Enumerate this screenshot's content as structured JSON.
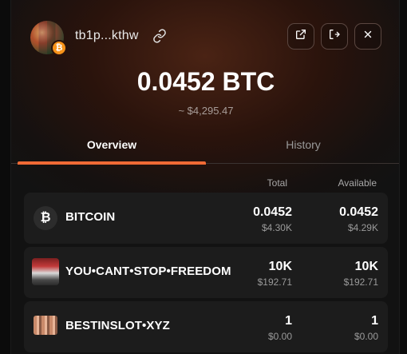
{
  "header": {
    "address": "tb1p...kthw",
    "icons": [
      "copy-link-icon",
      "external-link-icon",
      "logout-icon",
      "close-icon"
    ]
  },
  "balance": {
    "amount": "0.0452 BTC",
    "usd": "~ $4,295.47"
  },
  "tabs": [
    {
      "label": "Overview",
      "active": true
    },
    {
      "label": "History",
      "active": false
    }
  ],
  "columns": {
    "total": "Total",
    "available": "Available"
  },
  "assets": [
    {
      "name": "BITCOIN",
      "total": "0.0452",
      "total_usd": "$4.30K",
      "available": "0.0452",
      "available_usd": "$4.29K",
      "icon": "bitcoin-icon"
    },
    {
      "name": "YOU•CANT•STOP•FREEDOM",
      "total": "10K",
      "total_usd": "$192.71",
      "available": "10K",
      "available_usd": "$192.71",
      "icon": "rune-image"
    },
    {
      "name": "BESTINSLOT•XYZ",
      "total": "1",
      "total_usd": "$0.00",
      "available": "1",
      "available_usd": "$0.00",
      "icon": "rune-image"
    }
  ],
  "colors": {
    "accent": "#f06a35",
    "row_bg": "#1c1c1c",
    "bitcoin": "#f7931a"
  }
}
